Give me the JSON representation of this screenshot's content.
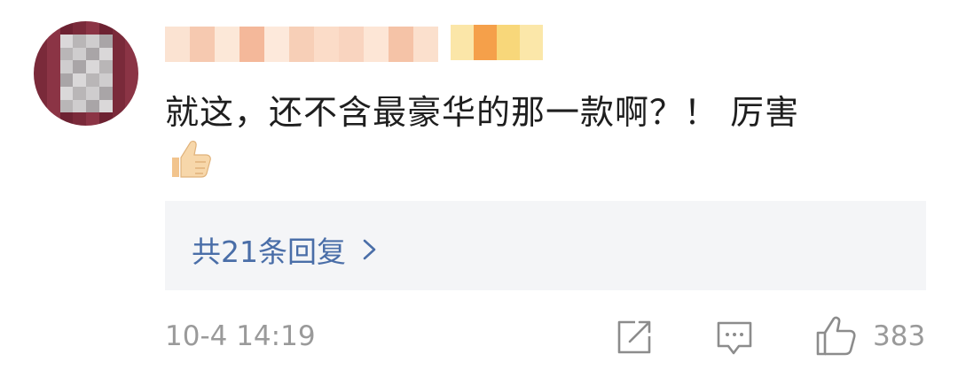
{
  "comment": {
    "text": "就这，还不含最豪华的那一款啊？！ 厉害",
    "emoji": "thumbs-up-emoji"
  },
  "replies": {
    "link_label": "共21条回复"
  },
  "footer": {
    "timestamp": "10-4 14:19",
    "like_count": "383"
  },
  "icons": {
    "share": "share-icon",
    "comment": "comment-icon",
    "like": "like-icon",
    "chevron": "chevron-right-icon"
  },
  "colors": {
    "reply_link": "#4a6ea8",
    "reply_box_bg": "#f4f5f7",
    "meta_gray": "#9a9a9a"
  }
}
